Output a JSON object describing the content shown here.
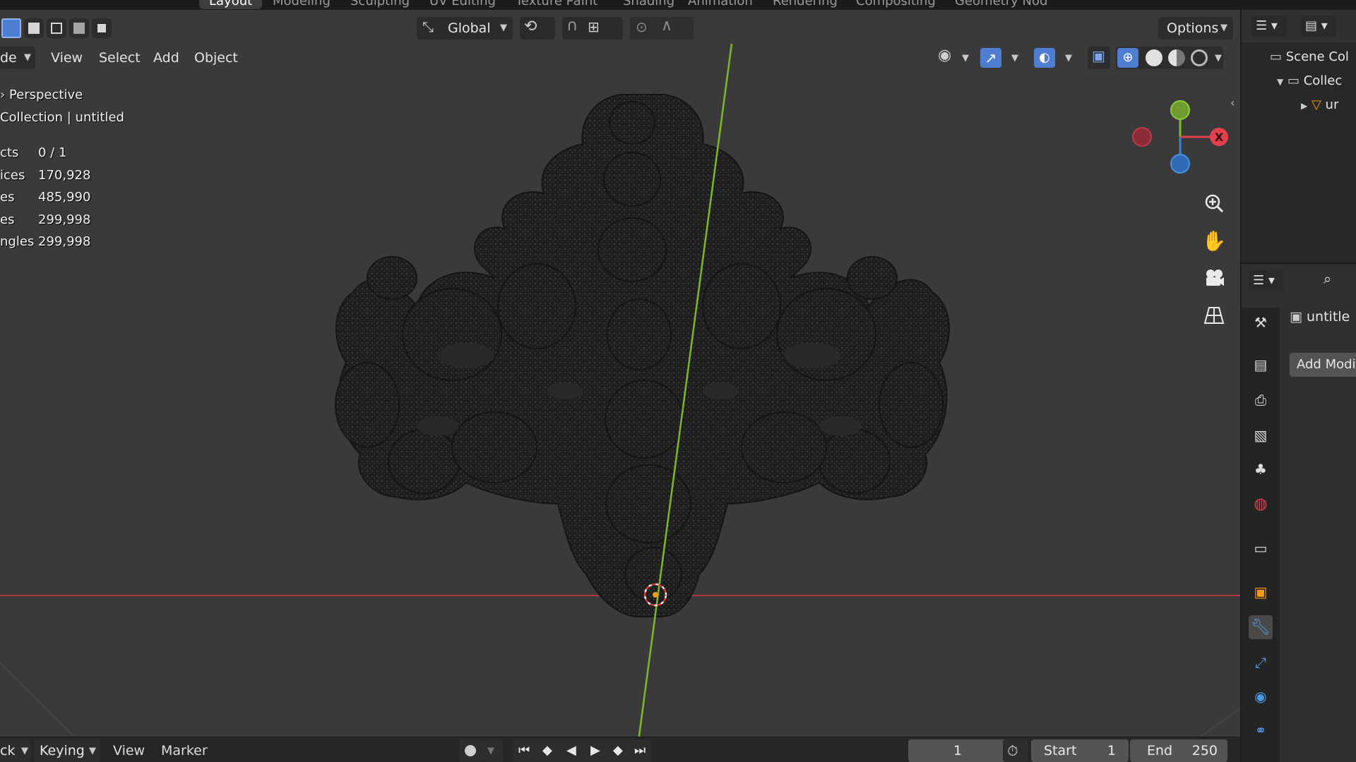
{
  "workspace_tabs": [
    "Layout",
    "Modeling",
    "Sculpting",
    "UV Editing",
    "Texture Paint",
    "Shading",
    "Animation",
    "Rendering",
    "Compositing",
    "Geometry Nod"
  ],
  "viewport_header": {
    "mode_label": "de",
    "menus": [
      "View",
      "Select",
      "Add",
      "Object"
    ],
    "transform_orientation": "Global",
    "options_label": "Options"
  },
  "overlay": {
    "view_name": "Perspective",
    "collection_line": "Collection | untitled",
    "stats": [
      {
        "label": "cts",
        "value": "0 / 1"
      },
      {
        "label": "ices",
        "value": "170,928"
      },
      {
        "label": "es",
        "value": "485,990"
      },
      {
        "label": "es",
        "value": "299,998"
      },
      {
        "label": "ngles",
        "value": "299,998"
      }
    ]
  },
  "gizmo": {
    "x_label": "X",
    "colors": {
      "x": "#e0414d",
      "y": "#7bbf2f",
      "z": "#3c82d7"
    }
  },
  "outliner": {
    "scene_collection": "Scene Col",
    "collection": "Collec",
    "object": "ur"
  },
  "properties": {
    "object_name": "untitle",
    "add_modifier": "Add Modif"
  },
  "timeline": {
    "playback_label": "ck",
    "keying_label": "Keying",
    "view_label": "View",
    "marker_label": "Marker",
    "current_frame": "1",
    "start_label": "Start",
    "start_value": "1",
    "end_label": "End",
    "end_value": "250"
  },
  "colors": {
    "viewport_bg": "#3a3a3a",
    "x_axis_line": "#b3373f",
    "y_axis_line": "#7cb82a",
    "accent_blue": "#4d7ed1"
  }
}
